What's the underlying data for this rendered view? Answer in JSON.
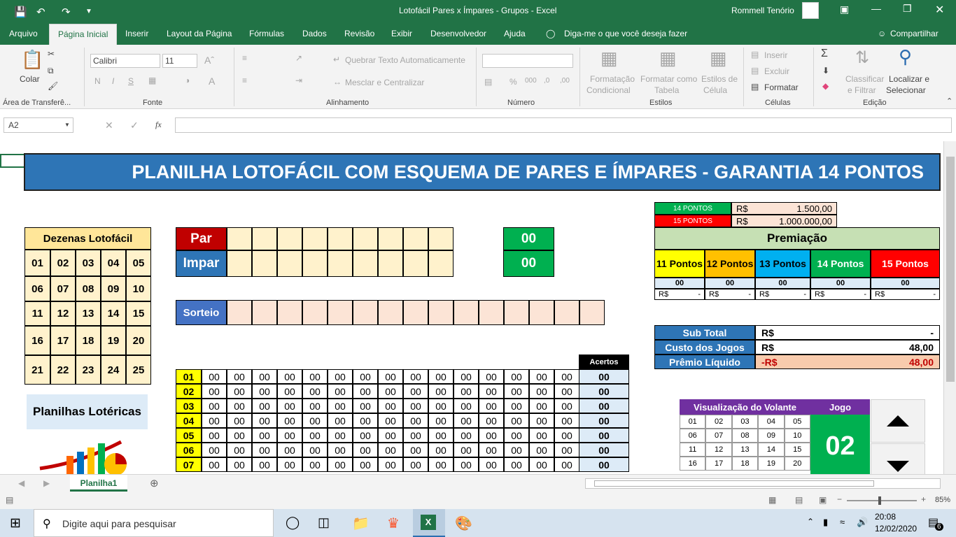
{
  "title": "Lotofácil Pares x Ímpares - Grupos  -  Excel",
  "user": "Rommell Tenório",
  "tabs": [
    "Arquivo",
    "Página Inicial",
    "Inserir",
    "Layout da Página",
    "Fórmulas",
    "Dados",
    "Revisão",
    "Exibir",
    "Desenvolvedor",
    "Ajuda"
  ],
  "tellme": "Diga-me o que você deseja fazer",
  "share": "Compartilhar",
  "ribbon": {
    "paste": "Colar",
    "clipboard": "Área de Transferê...",
    "font_name": "Calibri",
    "font_size": "11",
    "bold": "N",
    "italic": "I",
    "underline": "S",
    "font_group": "Fonte",
    "wrap": "Quebrar Texto Automaticamente",
    "merge": "Mesclar e Centralizar",
    "align_group": "Alinhamento",
    "number_group": "Número",
    "cond1": "Formatação",
    "cond2": "Condicional",
    "fmt1": "Formatar como",
    "fmt2": "Tabela",
    "sty1": "Estilos de",
    "sty2": "Célula",
    "styles_group": "Estilos",
    "insert": "Inserir",
    "delete": "Excluir",
    "format": "Formatar",
    "cells_group": "Células",
    "sort1": "Classificar",
    "sort2": "e Filtrar",
    "find1": "Localizar e",
    "find2": "Selecionar",
    "edit_group": "Edição"
  },
  "namebox": "A2",
  "sheet": {
    "banner": "PLANILHA LOTOFÁCIL COM ESQUEMA DE PARES E ÍMPARES - GARANTIA 14 PONTOS",
    "dezenas_title": "Dezenas Lotofácil",
    "dezenas": [
      [
        "01",
        "02",
        "03",
        "04",
        "05"
      ],
      [
        "06",
        "07",
        "08",
        "09",
        "10"
      ],
      [
        "11",
        "12",
        "13",
        "14",
        "15"
      ],
      [
        "16",
        "17",
        "18",
        "19",
        "20"
      ],
      [
        "21",
        "22",
        "23",
        "24",
        "25"
      ]
    ],
    "logo_text": "Planilhas Lotéricas",
    "par": "Par",
    "impar": "Impar",
    "par_count": "00",
    "impar_count": "00",
    "sorteio": "Sorteio",
    "acertos": "Acertos",
    "game_rows": [
      "01",
      "02",
      "03",
      "04",
      "05",
      "06",
      "07"
    ],
    "zero": "00",
    "prize_14_label": "14 PONTOS",
    "prize_14_cur": "R$",
    "prize_14_val": "1.500,00",
    "prize_15_label": "15 PONTOS",
    "prize_15_cur": "R$",
    "prize_15_val": "1.000.000,00",
    "premiacao": "Premiação",
    "pontos": [
      "11 Pontos",
      "12 Pontos",
      "13 Pontos",
      "14 Pontos",
      "15 Pontos"
    ],
    "rs": "R$",
    "dash": "-",
    "sub_total": "Sub Total",
    "custo": "Custo dos Jogos",
    "premio": "Prêmio Líquido",
    "sub_cur": "R$",
    "sub_val": "-",
    "custo_cur": "R$",
    "custo_val": "48,00",
    "premio_cur": "-R$",
    "premio_val": "48,00",
    "volante_title": "Visualização do Volante",
    "jogo_title": "Jogo",
    "jogo_num": "02",
    "volante": [
      [
        "01",
        "02",
        "03",
        "04",
        "05"
      ],
      [
        "06",
        "07",
        "08",
        "09",
        "10"
      ],
      [
        "11",
        "12",
        "13",
        "14",
        "15"
      ],
      [
        "16",
        "17",
        "18",
        "19",
        "20"
      ]
    ]
  },
  "sheet_tab": "Planilha1",
  "zoom": "85%",
  "search": "Digite aqui para pesquisar",
  "time": "20:08",
  "date": "12/02/2020",
  "notif": "6",
  "colors": {
    "excel_green": "#217346",
    "banner_blue": "#2e75b6",
    "par_red": "#c00000",
    "impar_blue": "#2e75b6",
    "green": "#00b050",
    "yellow": "#ffff00",
    "orange": "#ffc000",
    "cyan": "#00b0f0",
    "red": "#ff0000",
    "purple": "#7030a0",
    "light_orange": "#ffe699",
    "peach": "#fce4d6",
    "light_blue": "#ddebf7",
    "light_green": "#c6e0b4",
    "pink": "#f8cbad"
  }
}
